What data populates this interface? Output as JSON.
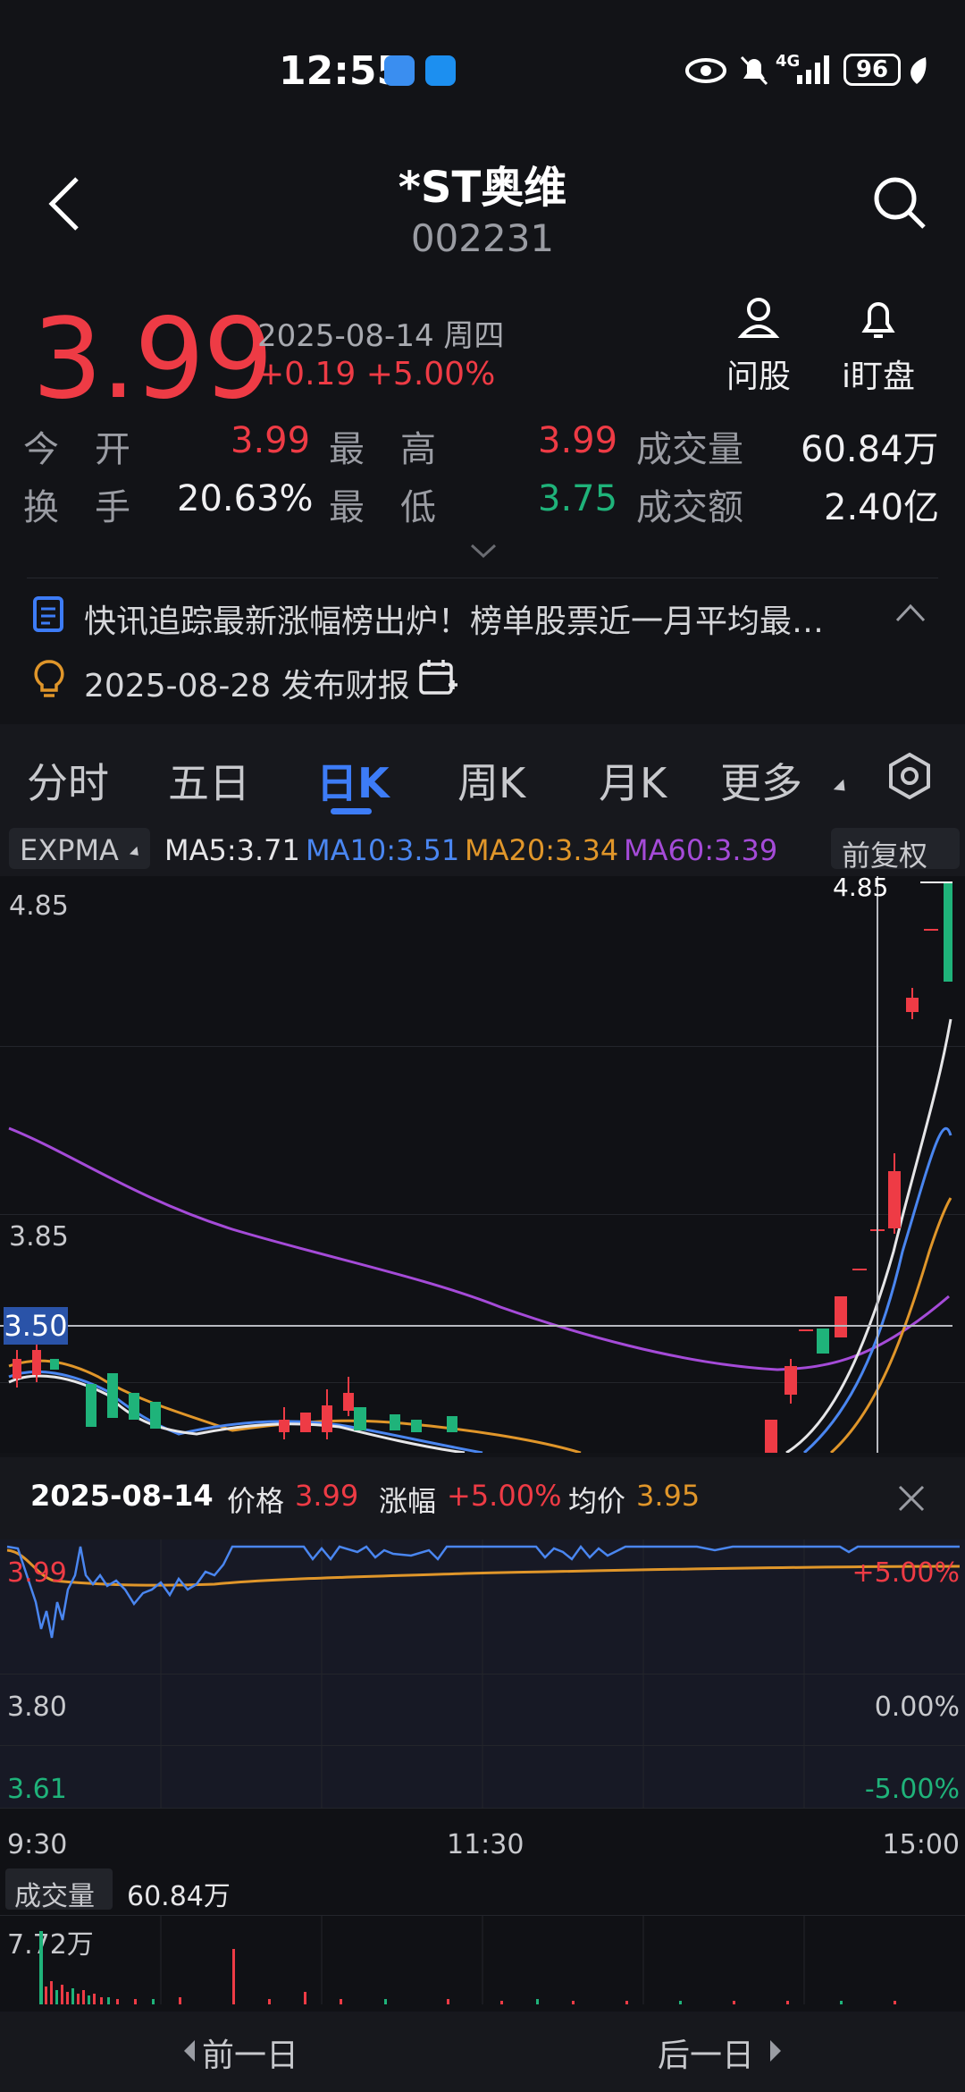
{
  "status": {
    "time": "12:55",
    "network": "4G",
    "battery": "96"
  },
  "header": {
    "title": "*ST奥维",
    "code": "002231"
  },
  "quote": {
    "price": "3.99",
    "date": "2025-08-14 周四",
    "change": "+0.19 +5.00%",
    "tools": [
      {
        "label": "问股",
        "icon": "person-icon"
      },
      {
        "label": "i盯盘",
        "icon": "bell-icon"
      }
    ]
  },
  "stats": {
    "open_label": "今　开",
    "open": "3.99",
    "high_label": "最　高",
    "high": "3.99",
    "volume_label": "成交量",
    "volume": "60.84万",
    "turnover_label": "换　手",
    "turnover": "20.63%",
    "low_label": "最　低",
    "low": "3.75",
    "amount_label": "成交额",
    "amount": "2.40亿"
  },
  "news": {
    "headline": "快讯追踪最新涨幅榜出炉！榜单股票近一月平均最…",
    "report": "2025-08-28 发布财报"
  },
  "tabs": [
    "分时",
    "五日",
    "日K",
    "周K",
    "月K",
    "更多"
  ],
  "active_tab": "日K",
  "indicators": {
    "type": "EXPMA",
    "ma5": "MA5:3.71",
    "ma10": "MA10:3.51",
    "ma20": "MA20:3.34",
    "ma60": "MA60:3.39",
    "adjust": "前复权"
  },
  "colors": {
    "up": "#ee3b45",
    "down": "#1fb37a",
    "accent": "#3d7cf7",
    "ma5": "#e6e6e8",
    "ma10": "#4a86f0",
    "ma20": "#e0962a",
    "ma60": "#a54bd8"
  },
  "kline": {
    "y_labels": [
      "4.85",
      "3.85"
    ],
    "crosshair_price": "3.50",
    "max_label": "4.85"
  },
  "intraday": {
    "date": "2025-08-14",
    "price_label": "价格",
    "price": "3.99",
    "change_label": "涨幅",
    "change": "+5.00%",
    "avg_label": "均价",
    "avg": "3.95",
    "y_left": [
      "3.99",
      "3.80",
      "3.61"
    ],
    "y_right": [
      "+5.00%",
      "0.00%",
      "-5.00%"
    ],
    "x_labels": [
      "9:30",
      "11:30",
      "15:00"
    ],
    "volume_label": "成交量",
    "volume": "60.84万",
    "volume_max": "7.72万"
  },
  "nav": {
    "prev": "前一日",
    "next": "后一日"
  }
}
